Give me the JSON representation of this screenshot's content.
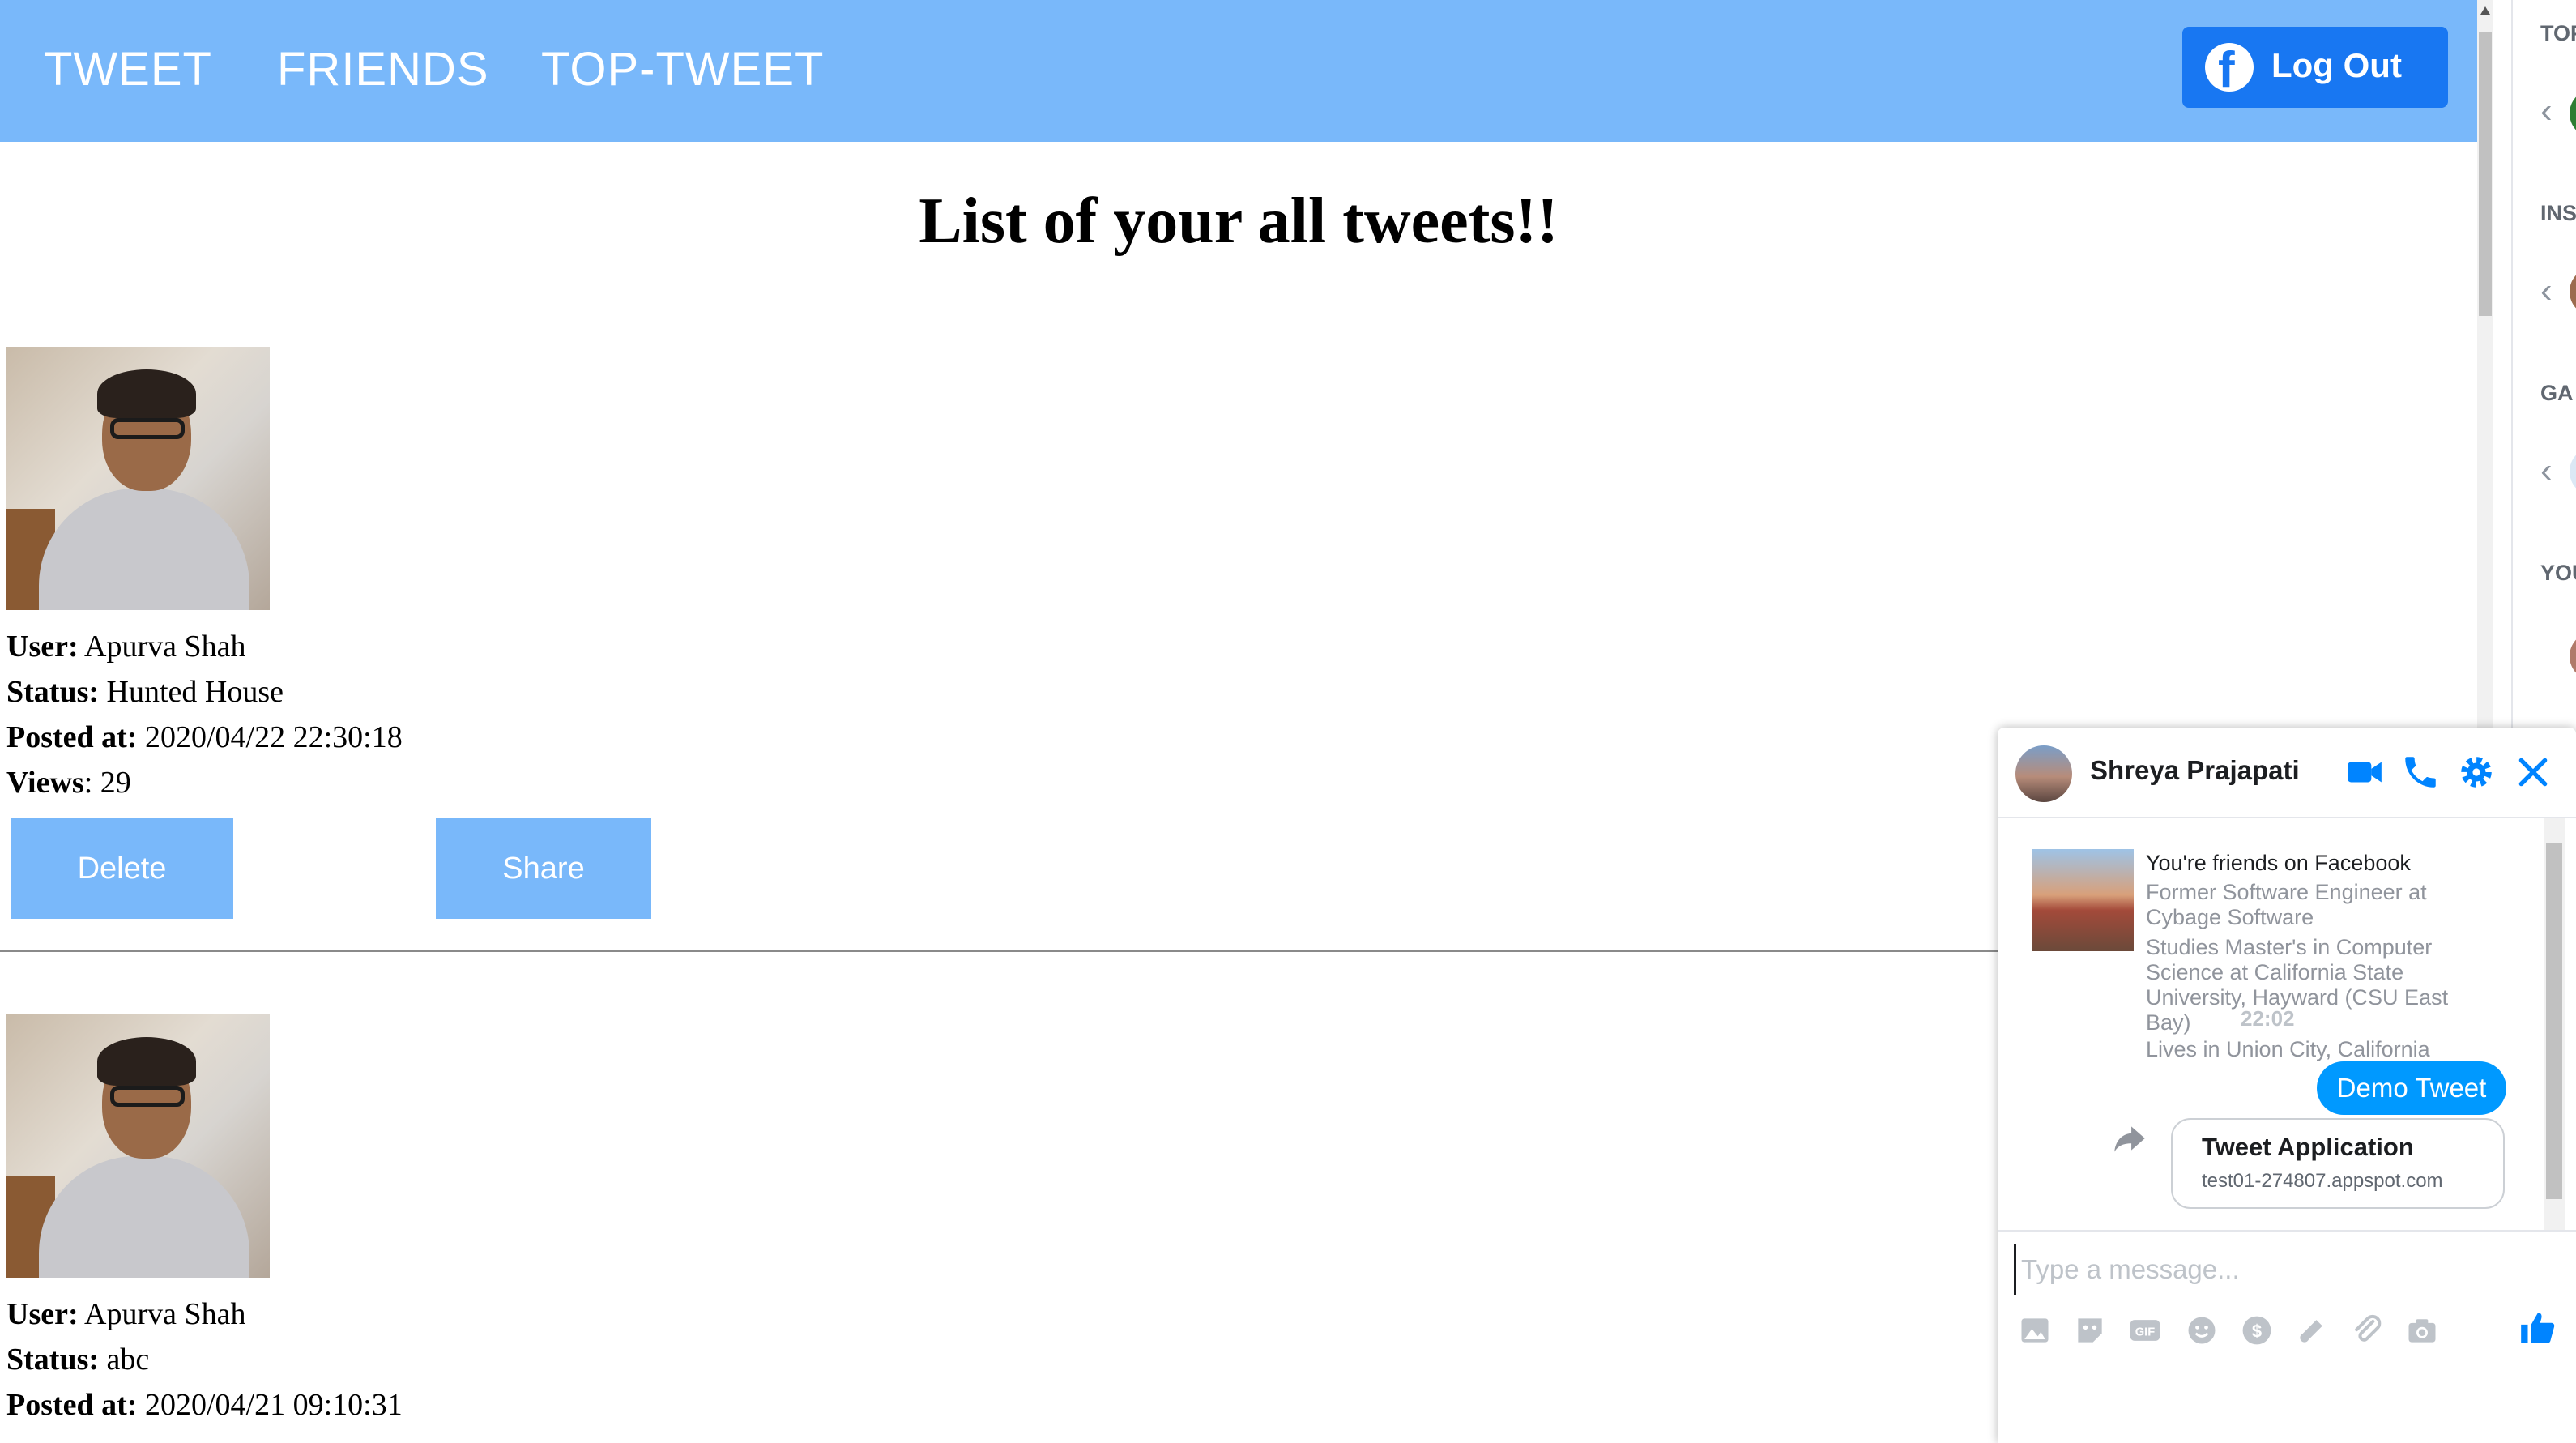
{
  "nav": {
    "tweet": "TWEET",
    "friends": "FRIENDS",
    "top_tweet": "TOP-TWEET",
    "logout": "Log Out"
  },
  "page": {
    "title": "List of your all tweets!!"
  },
  "labels": {
    "user": "User:",
    "status": "Status:",
    "posted_at": "Posted at:",
    "views": "Views"
  },
  "tweets": [
    {
      "user": "Apurva Shah",
      "status": "Hunted House",
      "posted_at": "2020/04/22 22:30:18",
      "views": ": 29",
      "delete": "Delete",
      "share": "Share"
    },
    {
      "user": "Apurva Shah",
      "status": "abc",
      "posted_at": "2020/04/21 09:10:31"
    }
  ],
  "sidebar": {
    "headings": [
      "TOP",
      "INS",
      "GA",
      "YOU"
    ]
  },
  "chat": {
    "name": "Shreya Prajapati",
    "friends_on": "You're friends on Facebook",
    "work": "Former Software Engineer at Cybage Software",
    "study": "Studies Master's in Computer Science at California State University, Hayward (CSU East Bay)",
    "lives": "Lives in Union City, California",
    "time": "22:02",
    "message": "Demo Tweet",
    "link_title": "Tweet Application",
    "link_url": "test01-274807.appspot.com",
    "input_placeholder": "Type a message..."
  },
  "colors": {
    "nav_bg": "#79b8fa",
    "button_bg": "#79b8fa",
    "facebook_blue": "#1877f2",
    "messenger_blue": "#0099ff"
  }
}
